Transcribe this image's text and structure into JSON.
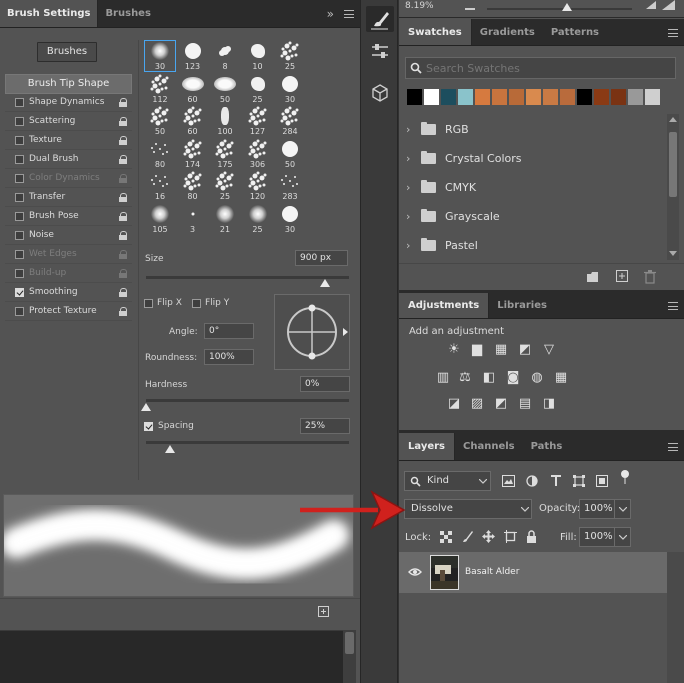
{
  "brush_settings": {
    "tabs": [
      "Brush Settings",
      "Brushes"
    ],
    "collapse_label": "»",
    "brushes_button": "Brushes",
    "tip_shape_label": "Brush Tip Shape",
    "options": [
      {
        "label": "Shape Dynamics",
        "checked": false,
        "dim": false
      },
      {
        "label": "Scattering",
        "checked": false,
        "dim": false
      },
      {
        "label": "Texture",
        "checked": false,
        "dim": false
      },
      {
        "label": "Dual Brush",
        "checked": false,
        "dim": false
      },
      {
        "label": "Color Dynamics",
        "checked": false,
        "dim": true
      },
      {
        "label": "Transfer",
        "checked": false,
        "dim": false
      },
      {
        "label": "Brush Pose",
        "checked": false,
        "dim": false
      },
      {
        "label": "Noise",
        "checked": false,
        "dim": false
      },
      {
        "label": "Wet Edges",
        "checked": false,
        "dim": true
      },
      {
        "label": "Build-up",
        "checked": false,
        "dim": true
      },
      {
        "label": "Smoothing",
        "checked": true,
        "dim": false
      },
      {
        "label": "Protect Texture",
        "checked": false,
        "dim": false
      }
    ],
    "presets": [
      "30",
      "123",
      "8",
      "10",
      "25",
      "112",
      "60",
      "50",
      "25",
      "30",
      "50",
      "60",
      "100",
      "127",
      "284",
      "80",
      "174",
      "175",
      "306",
      "50",
      "16",
      "80",
      "25",
      "120",
      "283",
      "105",
      "3",
      "21",
      "25",
      "30"
    ],
    "size_label": "Size",
    "size_value": "900 px",
    "size_fraction": 0.88,
    "flip_x_label": "Flip X",
    "flip_y_label": "Flip Y",
    "angle_label": "Angle:",
    "angle_value": "0°",
    "roundness_label": "Roundness:",
    "roundness_value": "100%",
    "hardness_label": "Hardness",
    "hardness_value": "0%",
    "hardness_fraction": 0,
    "spacing_label": "Spacing",
    "spacing_value": "25%",
    "spacing_fraction": 0.12,
    "new_brush_icon": "plus-box-icon"
  },
  "toolstrip": {
    "icons": [
      "brush-settings-icon",
      "properties-icon",
      "3d-cube-icon"
    ]
  },
  "top_strip": {
    "zoom_value": "8.19%",
    "zoom_fraction": 0.55
  },
  "swatches": {
    "tabs": [
      "Swatches",
      "Gradients",
      "Patterns"
    ],
    "search_placeholder": "Search Swatches",
    "colors": [
      "#000000",
      "#ffffff",
      "#1d4e5e",
      "#8ac3cb",
      "#d67a3f",
      "#c8743e",
      "#b86a38",
      "#d98a4e",
      "#c97a44",
      "#b96b3c",
      "#000000",
      "#8a3a14",
      "#7a3313",
      "#999999",
      "#cfcfcf"
    ],
    "groups": [
      "RGB",
      "Crystal Colors",
      "CMYK",
      "Grayscale",
      "Pastel"
    ],
    "footer_icons": [
      "folder-icon",
      "new-swatch-icon",
      "trash-icon"
    ]
  },
  "adjustments": {
    "tabs": [
      "Adjustments",
      "Libraries"
    ],
    "prompt": "Add an adjustment",
    "icons": [
      "brightness-icon",
      "levels-icon",
      "curves-icon",
      "exposure-icon",
      "vibrance-icon",
      "hue-saturation-icon",
      "color-balance-icon",
      "black-white-icon",
      "photo-filter-icon",
      "channel-mixer-icon",
      "color-lookup-icon",
      "invert-icon",
      "posterize-icon",
      "threshold-icon",
      "gradient-map-icon",
      "selective-color-icon"
    ]
  },
  "layers": {
    "tabs": [
      "Layers",
      "Channels",
      "Paths"
    ],
    "filter_label": "Kind",
    "blend_mode": "Dissolve",
    "opacity_label": "Opacity:",
    "opacity_value": "100%",
    "lock_label": "Lock:",
    "fill_label": "Fill:",
    "fill_value": "100%",
    "layer_name": "Basalt Alder"
  },
  "colors": {
    "accent_blue": "#49a6f0",
    "arrow_red": "#d0211d",
    "panel_bg": "#535353",
    "dark_bg": "#323232"
  }
}
